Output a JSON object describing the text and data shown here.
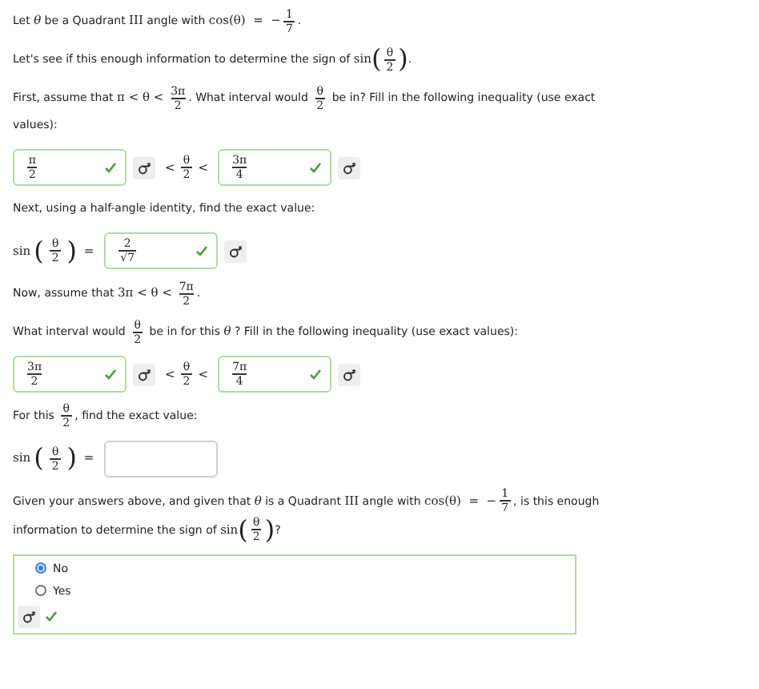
{
  "blocks": [
    {
      "kind": "para",
      "segments": [
        {
          "kind": "text",
          "text": "Let "
        },
        {
          "kind": "math",
          "text": "θ"
        },
        {
          "kind": "text",
          "text": " be a Quadrant "
        },
        {
          "kind": "math",
          "text": "III"
        },
        {
          "kind": "text",
          "text": " angle with "
        },
        {
          "kind": "math",
          "text": "cos(θ)  =  −"
        },
        {
          "kind": "frac",
          "num": "1",
          "den": "7"
        },
        {
          "kind": "text",
          "text": "."
        }
      ]
    },
    {
      "kind": "para",
      "segments": [
        {
          "kind": "text",
          "text": "Let's see if this enough information to determine the sign of "
        },
        {
          "kind": "math",
          "text": "sin"
        },
        {
          "kind": "paren",
          "text": "("
        },
        {
          "kind": "frac",
          "num": "θ",
          "den": "2"
        },
        {
          "kind": "paren",
          "text": ")"
        },
        {
          "kind": "text",
          "text": "."
        }
      ]
    },
    {
      "kind": "para",
      "segments": [
        {
          "kind": "text",
          "text": "First, assume that "
        },
        {
          "kind": "math",
          "text": "π < θ < "
        },
        {
          "kind": "frac",
          "num": "3π",
          "den": "2"
        },
        {
          "kind": "text",
          "text": ". What interval would "
        },
        {
          "kind": "frac",
          "num": "θ",
          "den": "2"
        },
        {
          "kind": "text",
          "text": " be in? Fill in the following inequality (use exact values):"
        }
      ]
    },
    {
      "kind": "inequality",
      "left": {
        "num": "π",
        "den": "2",
        "correct": true,
        "editor": true
      },
      "middle": [
        {
          "kind": "math",
          "text": "<"
        },
        {
          "kind": "frac",
          "num": "θ",
          "den": "2"
        },
        {
          "kind": "math",
          "text": "<"
        }
      ],
      "right": {
        "num": "3π",
        "den": "4",
        "correct": true,
        "editor": true
      }
    },
    {
      "kind": "para",
      "segments": [
        {
          "kind": "text",
          "text": "Next, using a half-angle identity, find the exact value:"
        }
      ]
    },
    {
      "kind": "equation",
      "lhs": [
        {
          "kind": "math",
          "text": "sin"
        },
        {
          "kind": "paren",
          "text": "("
        },
        {
          "kind": "frac",
          "num": "θ",
          "den": "2"
        },
        {
          "kind": "paren",
          "text": ")"
        },
        {
          "kind": "math",
          "text": " = "
        }
      ],
      "field": {
        "num": "2",
        "den": "√7",
        "correct": true,
        "editor": true
      }
    },
    {
      "kind": "para",
      "segments": [
        {
          "kind": "text",
          "text": "Now, assume that "
        },
        {
          "kind": "math",
          "text": "3π < θ < "
        },
        {
          "kind": "frac",
          "num": "7π",
          "den": "2"
        },
        {
          "kind": "text",
          "text": "."
        }
      ]
    },
    {
      "kind": "para",
      "segments": [
        {
          "kind": "text",
          "text": "What interval would "
        },
        {
          "kind": "frac",
          "num": "θ",
          "den": "2"
        },
        {
          "kind": "text",
          "text": " be in for this "
        },
        {
          "kind": "math",
          "text": "θ"
        },
        {
          "kind": "text",
          "text": " ? Fill in the following inequality (use exact values):"
        }
      ]
    },
    {
      "kind": "inequality",
      "left": {
        "num": "3π",
        "den": "2",
        "correct": true,
        "editor": true
      },
      "middle": [
        {
          "kind": "math",
          "text": "<"
        },
        {
          "kind": "frac",
          "num": "θ",
          "den": "2"
        },
        {
          "kind": "math",
          "text": "<"
        }
      ],
      "right": {
        "num": "7π",
        "den": "4",
        "correct": true,
        "editor": true
      }
    },
    {
      "kind": "para",
      "segments": [
        {
          "kind": "text",
          "text": "For this "
        },
        {
          "kind": "frac",
          "num": "θ",
          "den": "2"
        },
        {
          "kind": "text",
          "text": ", find the exact value:"
        }
      ]
    },
    {
      "kind": "equation",
      "lhs": [
        {
          "kind": "math",
          "text": "sin"
        },
        {
          "kind": "paren",
          "text": "("
        },
        {
          "kind": "frac",
          "num": "θ",
          "den": "2"
        },
        {
          "kind": "paren",
          "text": ")"
        },
        {
          "kind": "math",
          "text": " = "
        }
      ],
      "field": {
        "correct": false,
        "editor": false
      }
    },
    {
      "kind": "para",
      "segments": [
        {
          "kind": "text",
          "text": "Given your answers above, and given that "
        },
        {
          "kind": "math",
          "text": "θ"
        },
        {
          "kind": "text",
          "text": " is a Quadrant "
        },
        {
          "kind": "math",
          "text": "III"
        },
        {
          "kind": "text",
          "text": " angle with "
        },
        {
          "kind": "math",
          "text": "cos(θ)  =  −"
        },
        {
          "kind": "frac",
          "num": "1",
          "den": "7"
        },
        {
          "kind": "text",
          "text": ", is this enough information to determine the sign of "
        },
        {
          "kind": "math",
          "text": "sin"
        },
        {
          "kind": "paren",
          "text": "("
        },
        {
          "kind": "frac",
          "num": "θ",
          "den": "2"
        },
        {
          "kind": "paren",
          "text": ")"
        },
        {
          "kind": "text",
          "text": "?"
        }
      ]
    },
    {
      "kind": "choice",
      "correct": true,
      "options": [
        {
          "label": "No",
          "selected": true
        },
        {
          "label": "Yes",
          "selected": false
        }
      ]
    }
  ]
}
